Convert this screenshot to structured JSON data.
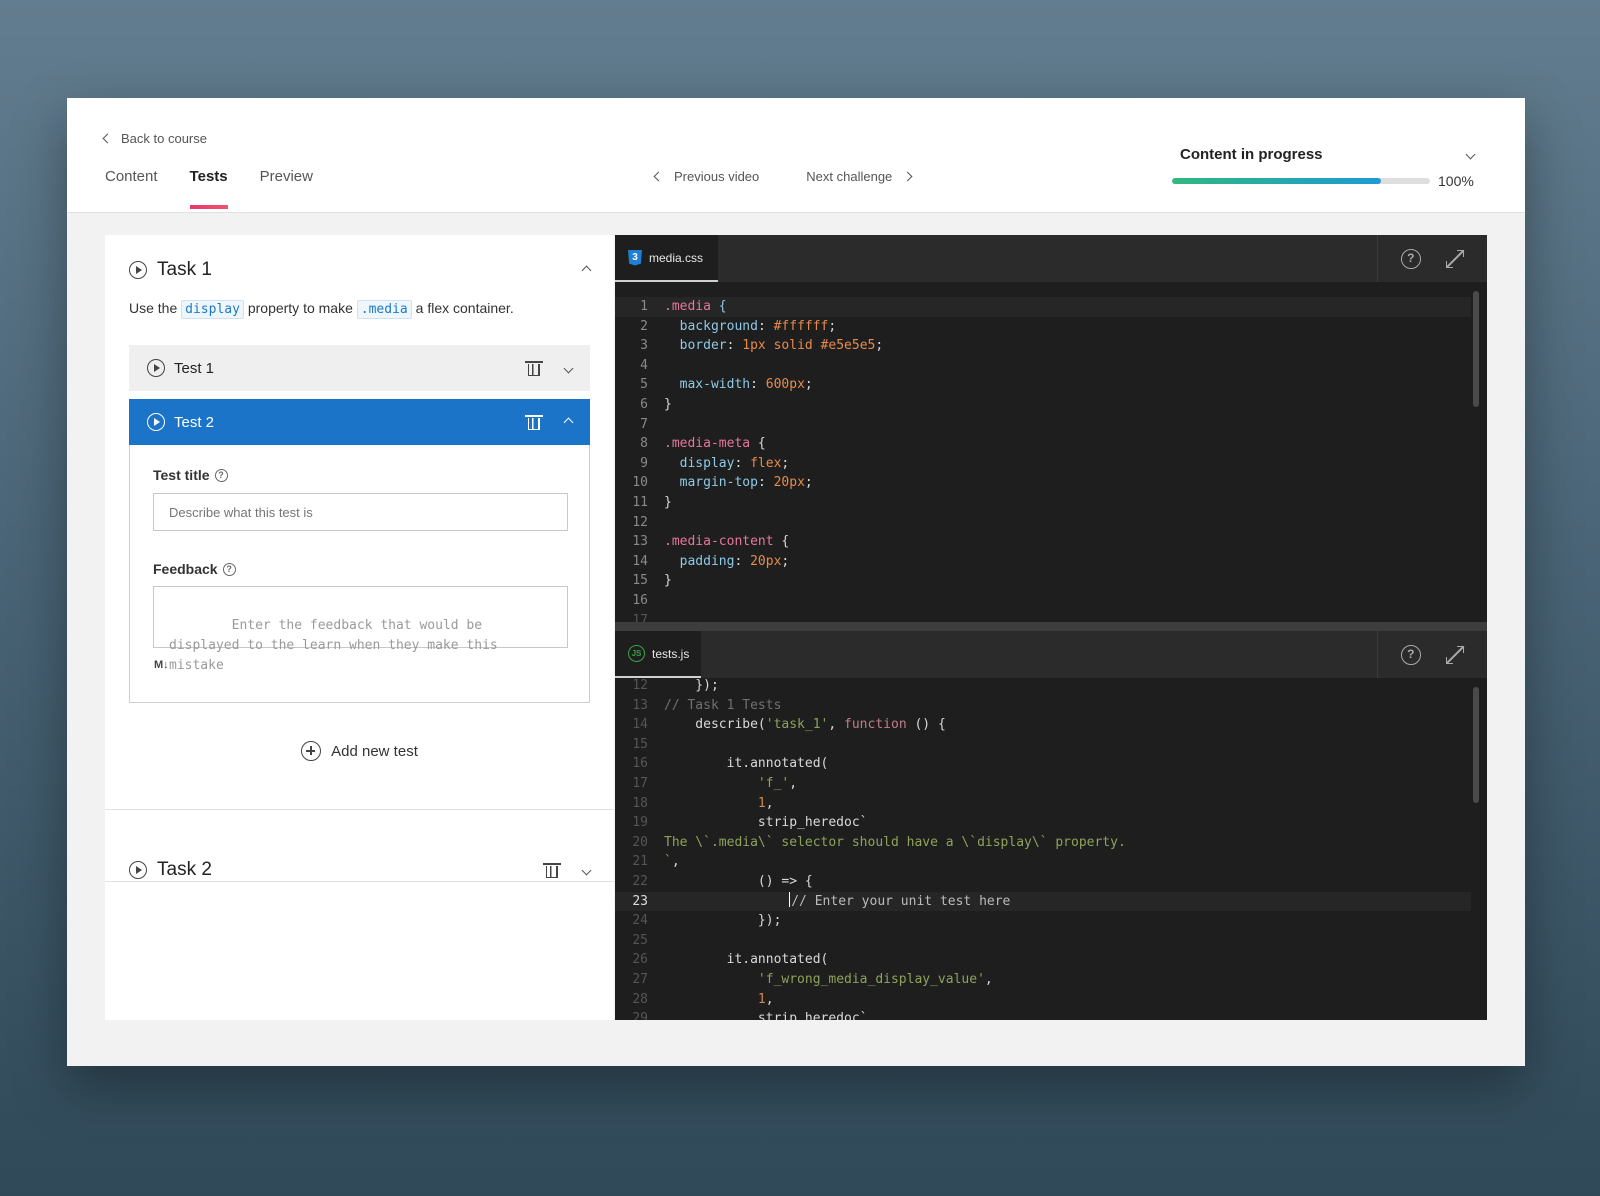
{
  "header": {
    "back_label": "Back to course",
    "tabs": [
      {
        "label": "Content",
        "active": false
      },
      {
        "label": "Tests",
        "active": true
      },
      {
        "label": "Preview",
        "active": false
      }
    ],
    "prev_label": "Previous video",
    "next_label": "Next challenge",
    "status_label": "Content in progress",
    "progress_percent_text": "100%",
    "progress_fill": 0.81
  },
  "task1": {
    "title": "Task 1",
    "desc_prefix": "Use the",
    "desc_code1": "display",
    "desc_middle": "property to make",
    "desc_code2": ".media",
    "desc_suffix": "a flex container.",
    "tests": [
      {
        "label": "Test 1"
      },
      {
        "label": "Test 2"
      }
    ],
    "test_title_label": "Test title",
    "test_title_placeholder": "Describe what this test is",
    "feedback_label": "Feedback",
    "feedback_placeholder": "Enter the feedback that would be displayed to the learn when they make this mistake",
    "markdown_badge": "M↓",
    "add_test_label": "Add new test"
  },
  "task2": {
    "title": "Task 2"
  },
  "css_editor": {
    "filename": "media.css",
    "badge": "3"
  },
  "js_editor": {
    "filename": "tests.js",
    "badge": "JS"
  },
  "colors": {
    "accent_blue": "#1c74c8",
    "tab_underline": "#e8396b",
    "progress_start": "#2fb87f",
    "progress_end": "#1e9ad6"
  }
}
